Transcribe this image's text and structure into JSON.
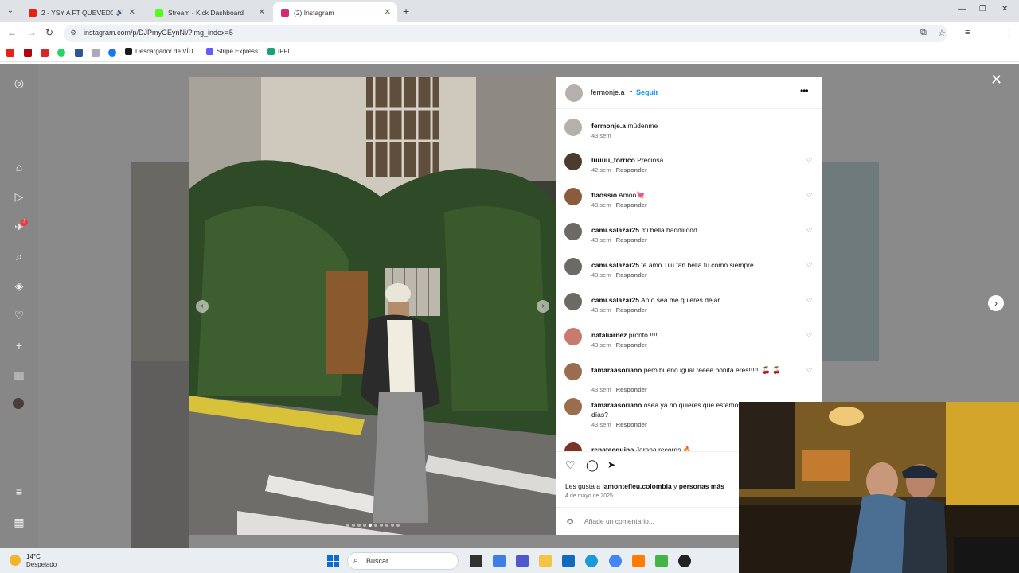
{
  "browser": {
    "tabs": [
      {
        "title": "2 - YSY A FT QUEVEDO - LL",
        "color": "#e62117"
      },
      {
        "title": "Stream - Kick Dashboard",
        "color": "#53fc18"
      },
      {
        "title": "(2) Instagram",
        "color": "#d62976"
      }
    ],
    "url": "instagram.com/p/DJPmyGEynNi/?img_index=5",
    "bookmarks": [
      {
        "label": "Descargador de VÍD...",
        "color": "#1a1a1a"
      },
      {
        "label": "Stripe Express",
        "color": "#635bff"
      },
      {
        "label": "IPFL",
        "color": "#1aa37a"
      }
    ]
  },
  "post": {
    "author": "fermonje.a",
    "separator": "•",
    "follow_label": "Seguir",
    "more_icon": "•••",
    "likes_prefix": "Les gusta a",
    "likes_user": "lamontefleu.colombia",
    "likes_and": "y",
    "likes_others": "personas más",
    "date": "4 de mayo de 2025",
    "comment_placeholder": "Añade un comentario...",
    "reply_label": "Responder",
    "carousel_index": 5,
    "carousel_count": 10
  },
  "comments": [
    {
      "user": "fermonje.a",
      "text": "múdenme",
      "time": "43 sem",
      "reply": false,
      "avatar": "#b5b0ab"
    },
    {
      "user": "luuuu_torrico",
      "text": "Preciosa",
      "time": "42 sem",
      "reply": true,
      "avatar": "#4a3d2e"
    },
    {
      "user": "flaossio",
      "text": "Amoo💘",
      "time": "43 sem",
      "reply": true,
      "avatar": "#8c5a3c"
    },
    {
      "user": "cami.salazar25",
      "text": "mi bella haddiiiddd",
      "time": "43 sem",
      "reply": true,
      "avatar": "#6d6a66"
    },
    {
      "user": "cami.salazar25",
      "text": "te amo Tilu tan bella tu como siempre",
      "time": "43 sem",
      "reply": true,
      "avatar": "#6d6a66"
    },
    {
      "user": "cami.salazar25",
      "text": "Ah o sea me quieres dejar",
      "time": "43 sem",
      "reply": true,
      "avatar": "#6d6a66"
    },
    {
      "user": "nataliarnez",
      "text": "pronto !!!!",
      "time": "43 sem",
      "reply": true,
      "avatar": "#c97a6e"
    },
    {
      "user": "tamaraasoriano",
      "text": "pero bueno igual reeee bonita eres!!!!!! 🍒 🍒",
      "time": "43 sem",
      "reply": true,
      "avatar": "#9a6d4e"
    },
    {
      "user": "tamaraasoriano",
      "text": "ósea ya no quieres que estemos juntas todos los días?",
      "time": "43 sem",
      "reply": true,
      "avatar": "#9a6d4e"
    },
    {
      "user": "renataeguino",
      "text": "Jarana records 🔥",
      "time": "",
      "reply": false,
      "avatar": "#7a3324"
    }
  ],
  "taskbar": {
    "temp": "14°C",
    "weather": "Despejado",
    "search_label": "Buscar"
  },
  "icons": {
    "close": "✕",
    "next": "›",
    "prev": "‹",
    "heart": "♡",
    "comment": "◯",
    "share": "➤",
    "emoji": "☺"
  }
}
